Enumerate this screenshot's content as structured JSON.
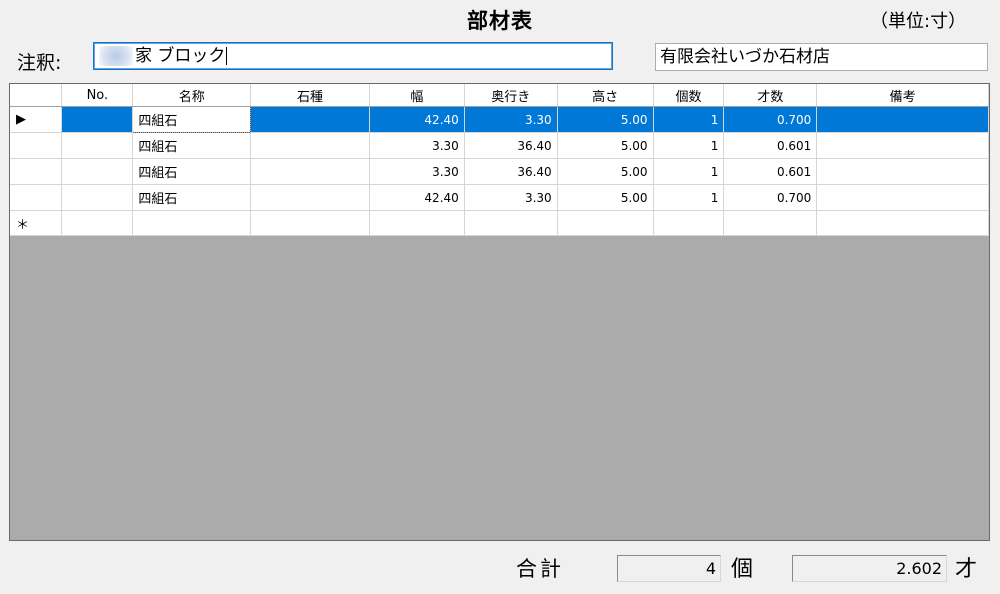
{
  "header": {
    "title": "部材表",
    "unit": "（単位:寸）"
  },
  "note": {
    "label": "注釈:",
    "value": "家 ブロック"
  },
  "company": {
    "value": "有限会社いづか石材店"
  },
  "grid": {
    "columns": [
      "No.",
      "名称",
      "石種",
      "幅",
      "奥行き",
      "高さ",
      "個数",
      "才数",
      "備考"
    ],
    "rows": [
      {
        "marker": "▶",
        "no": "",
        "name": "四組石",
        "stone": "",
        "width": "42.40",
        "depth": "3.30",
        "height": "5.00",
        "count": "1",
        "size": "0.700",
        "note": ""
      },
      {
        "marker": "",
        "no": "",
        "name": "四組石",
        "stone": "",
        "width": "3.30",
        "depth": "36.40",
        "height": "5.00",
        "count": "1",
        "size": "0.601",
        "note": ""
      },
      {
        "marker": "",
        "no": "",
        "name": "四組石",
        "stone": "",
        "width": "3.30",
        "depth": "36.40",
        "height": "5.00",
        "count": "1",
        "size": "0.601",
        "note": ""
      },
      {
        "marker": "",
        "no": "",
        "name": "四組石",
        "stone": "",
        "width": "42.40",
        "depth": "3.30",
        "height": "5.00",
        "count": "1",
        "size": "0.700",
        "note": ""
      }
    ],
    "new_row_marker": "＊",
    "selected_row": 0
  },
  "footer": {
    "total_label": "合計",
    "count_value": "4",
    "count_unit": "個",
    "size_value": "2.602",
    "size_unit": "才"
  }
}
